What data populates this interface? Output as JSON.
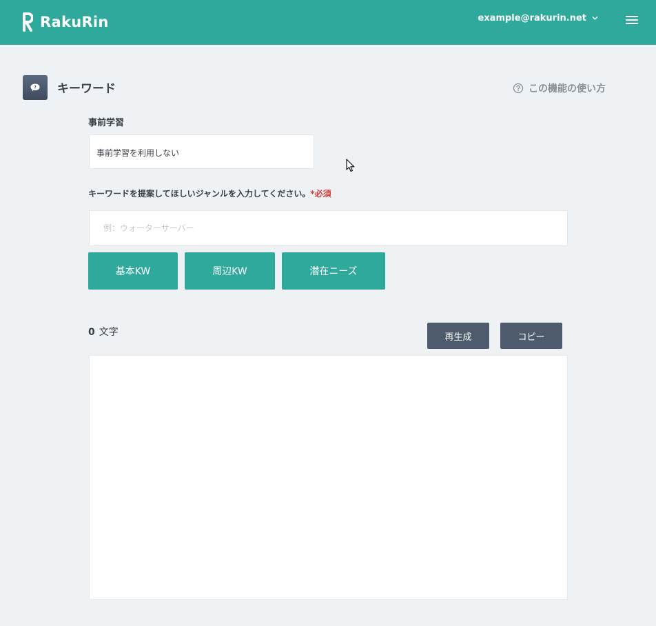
{
  "header": {
    "brand": "RakuRin",
    "account_email": "example@rakurin.net",
    "icons": {
      "logo": "rakurin-logo-icon",
      "account_dropdown": "chevron-down-icon",
      "menu": "hamburger-menu-icon"
    },
    "colors": {
      "header_bg": "#2ea99b"
    }
  },
  "page": {
    "icon": "chat-bubble-icon",
    "title": "キーワード",
    "help_link": "この機能の使い方",
    "help_icon": "question-circle-icon"
  },
  "form": {
    "prelearn_label": "事前学習",
    "prelearn_value": "事前学習を利用しない",
    "genre_label": "キーワードを提案してほしいジャンルを入力してください。",
    "required_mark": "*必須",
    "genre_placeholder": "例：ウォーターサーバー",
    "genre_value": "",
    "buttons": {
      "basic_kw": "基本KW",
      "around_kw": "周辺KW",
      "latent_needs": "潜在ニーズ"
    }
  },
  "result": {
    "char_count": "0",
    "char_unit": "文字",
    "regenerate_label": "再生成",
    "copy_label": "コピー",
    "output_text": ""
  },
  "theme": {
    "accent": "#2ea99b",
    "dark_button": "#4e5b6d",
    "required_color": "#d04040",
    "background": "#eef2f4"
  }
}
